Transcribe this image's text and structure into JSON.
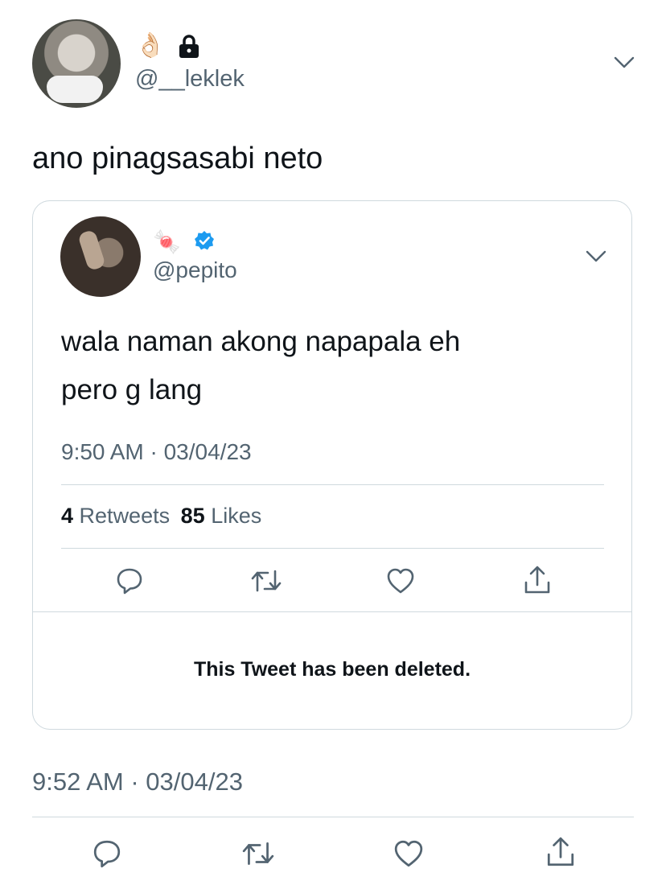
{
  "main_tweet": {
    "emoji_name": "👌🏻",
    "protected_icon": "lock-icon",
    "handle": "@__leklek",
    "text": "ano pinagsasabi neto",
    "timestamp": "9:52 AM · 03/04/23"
  },
  "quoted_tweet": {
    "emoji_name": "🍬",
    "verified_icon": "verified-badge-icon",
    "handle": "@pepito",
    "text_line1": "wala naman akong napapala eh",
    "text_line2": "pero g lang",
    "timestamp": "9:50 AM · 03/04/23",
    "retweets_count": "4",
    "retweets_label": "Retweets",
    "likes_count": "85",
    "likes_label": "Likes",
    "deleted_notice": "This Tweet has been deleted."
  },
  "actions": [
    "reply-icon",
    "retweet-icon",
    "like-icon",
    "share-icon"
  ],
  "colors": {
    "text": "#0f1419",
    "secondary": "#536471",
    "divider": "#cfd9de",
    "verified": "#1d9bf0"
  }
}
